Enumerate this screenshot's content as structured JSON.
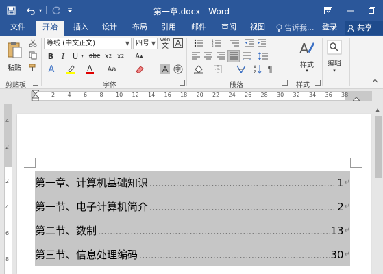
{
  "app": {
    "doc_title": "第一章.docx - Word"
  },
  "tabs": [
    {
      "label": "文件"
    },
    {
      "label": "开始"
    },
    {
      "label": "插入"
    },
    {
      "label": "设计"
    },
    {
      "label": "布局"
    },
    {
      "label": "引用"
    },
    {
      "label": "邮件"
    },
    {
      "label": "审阅"
    },
    {
      "label": "视图"
    }
  ],
  "tell_me": "告诉我...",
  "sign_in": "登录",
  "share": "共享",
  "ribbon": {
    "clipboard": {
      "paste_label": "粘贴",
      "group_label": "剪贴板"
    },
    "font": {
      "font_name": "等线 (中文正文)",
      "font_size": "四号",
      "group_label": "字体",
      "wen_label": "wén",
      "wen_char": "文"
    },
    "paragraph": {
      "group_label": "段落"
    },
    "styles": {
      "label": "样式",
      "group_label": "样式"
    },
    "editing": {
      "label": "编辑"
    }
  },
  "ruler": {
    "numbers": [
      "2",
      "4",
      "6",
      "8",
      "10",
      "12",
      "14",
      "16",
      "18",
      "20",
      "22",
      "24",
      "26",
      "28",
      "30",
      "32",
      "34",
      "36",
      "38"
    ],
    "tab_selector": "L"
  },
  "vruler": {
    "numbers": [
      "4",
      "2",
      "2",
      "4",
      "6",
      "8"
    ]
  },
  "toc": [
    {
      "title": "第一章、计算机基础知识",
      "page": "1"
    },
    {
      "title": "第一节、电子计算机简介",
      "page": "2"
    },
    {
      "title": "第二节、数制",
      "page": "13"
    },
    {
      "title": "第三节、信息处理编码",
      "page": "30"
    }
  ],
  "colors": {
    "brand": "#2b579a",
    "ribbon_bg": "#f3f3f3",
    "selection": "#c6c6c6"
  }
}
